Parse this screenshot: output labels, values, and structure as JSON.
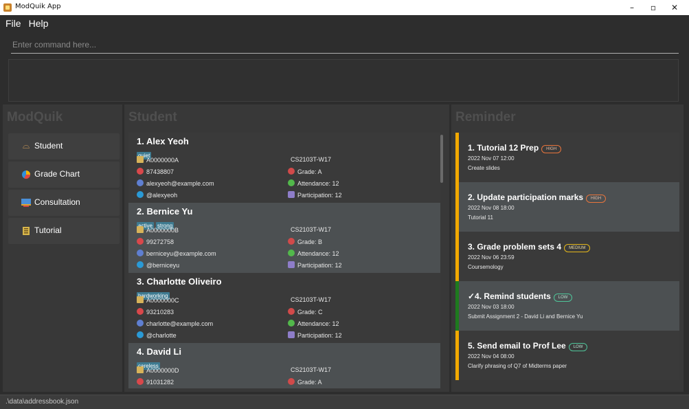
{
  "window": {
    "title": "ModQuik App",
    "minimize": "–",
    "restore": "▫",
    "close": "✕"
  },
  "menu": [
    "File",
    "Help"
  ],
  "command": {
    "placeholder": "Enter command here..."
  },
  "nav": {
    "heading": "ModQuik",
    "items": [
      {
        "label": "Student",
        "icon": "glasses-icon"
      },
      {
        "label": "Grade Chart",
        "icon": "pie-chart-icon"
      },
      {
        "label": "Consultation",
        "icon": "consultation-icon"
      },
      {
        "label": "Tutorial",
        "icon": "notebook-icon"
      }
    ]
  },
  "students": {
    "heading": "Student",
    "items": [
      {
        "name": "1.  Alex Yeoh",
        "tags": [
          "quiet"
        ],
        "id": "A0000000A",
        "phone": "87438807",
        "email": "alexyeoh@example.com",
        "telegram": "@alexyeoh",
        "class": "CS2103T-W17",
        "grade": "Grade: A",
        "attendance": "Attendance: 12",
        "participation": "Participation: 12"
      },
      {
        "name": "2.  Bernice Yu",
        "tags": [
          "active",
          "strong"
        ],
        "id": "A0000000B",
        "phone": "99272758",
        "email": "berniceyu@example.com",
        "telegram": "@berniceyu",
        "class": "CS2103T-W17",
        "grade": "Grade: B",
        "attendance": "Attendance: 12",
        "participation": "Participation: 12"
      },
      {
        "name": "3.  Charlotte Oliveiro",
        "tags": [
          "hardworking"
        ],
        "id": "A0000000C",
        "phone": "93210283",
        "email": "charlotte@example.com",
        "telegram": "@charlotte",
        "class": "CS2103T-W17",
        "grade": "Grade: C",
        "attendance": "Attendance: 12",
        "participation": "Participation: 12"
      },
      {
        "name": "4.  David Li",
        "tags": [
          "careless"
        ],
        "id": "A0000000D",
        "phone": "91031282",
        "class": "CS2103T-W17",
        "grade": "Grade: A"
      }
    ]
  },
  "reminders": {
    "heading": "Reminder",
    "items": [
      {
        "title": "1.  Tutorial 12 Prep",
        "priority": "HIGH",
        "level": "high",
        "date": "2022 Nov 07 12:00",
        "desc": "Create slides",
        "done": false,
        "bar_color": "#f2a900"
      },
      {
        "title": "2.  Update participation marks",
        "priority": "HIGH",
        "level": "high",
        "date": "2022 Nov 08 18:00",
        "desc": "Tutorial 11",
        "done": false,
        "bar_color": "#f2a900"
      },
      {
        "title": "3.  Grade problem sets 4",
        "priority": "MEDIUM",
        "level": "medium",
        "date": "2022 Nov 06 23:59",
        "desc": "Coursemology",
        "done": false,
        "bar_color": "#f2a900"
      },
      {
        "title": "✓4.  Remind students",
        "priority": "LOW",
        "level": "low",
        "date": "2022 Nov 03 18:00",
        "desc": "Submit Assignment 2 - David Li and Bernice Yu",
        "done": true,
        "bar_color": "#1e7a1e"
      },
      {
        "title": "5.  Send email to Prof Lee",
        "priority": "LOW",
        "level": "low",
        "date": "2022 Nov 04 08:00",
        "desc": "Clarify phrasing of Q7 of Midterms paper",
        "done": false,
        "bar_color": "#f2a900"
      }
    ]
  },
  "status": {
    "path": ".\\data\\addressbook.json"
  }
}
